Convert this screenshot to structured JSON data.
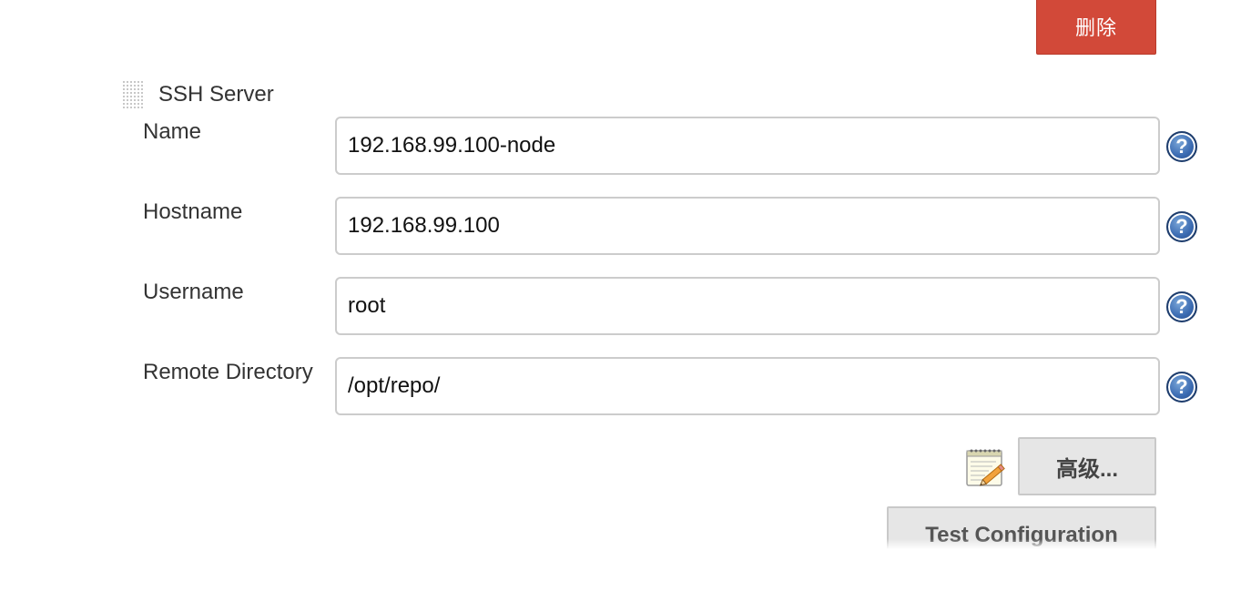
{
  "toolbar": {
    "delete_label": "删除"
  },
  "ssh_server": {
    "title": "SSH Server",
    "fields": [
      {
        "label": "Name",
        "value": "192.168.99.100-node"
      },
      {
        "label": "Hostname",
        "value": "192.168.99.100"
      },
      {
        "label": "Username",
        "value": "root"
      },
      {
        "label": "Remote Directory",
        "value": "/opt/repo/"
      }
    ],
    "help_glyph": "?",
    "advanced_label": "高级...",
    "test_label": "Test Configuration"
  },
  "icons": {
    "drag": "drag-handle-icon",
    "help": "help-icon",
    "notepad": "notepad-pencil-icon"
  },
  "colors": {
    "delete_button": "#d24939",
    "help_icon": "#3a6ab1",
    "button_bg": "#e6e6e6"
  }
}
